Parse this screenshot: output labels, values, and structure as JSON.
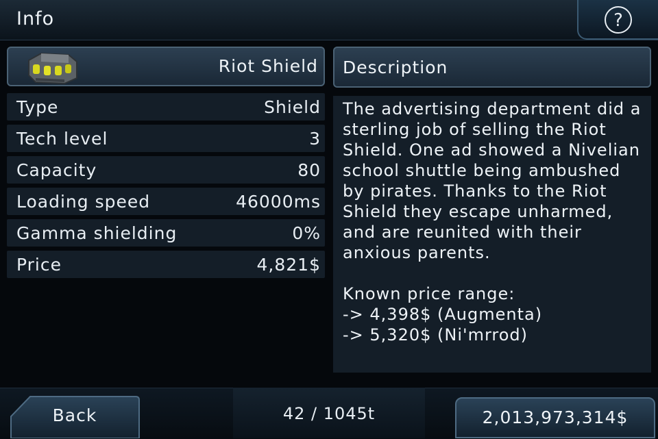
{
  "header": {
    "title": "Info",
    "help_icon": "?"
  },
  "item": {
    "name": "Riot Shield",
    "thumbnail_icon": "shield-generator-icon"
  },
  "stats": [
    {
      "label": "Type",
      "value": "Shield"
    },
    {
      "label": "Tech level",
      "value": "3"
    },
    {
      "label": "Capacity",
      "value": "80"
    },
    {
      "label": "Loading speed",
      "value": "46000ms"
    },
    {
      "label": "Gamma shielding",
      "value": "0%"
    },
    {
      "label": "Price",
      "value": "4,821$"
    }
  ],
  "description": {
    "title": "Description",
    "text": "The advertising department did a sterling job of selling the Riot Shield. One ad showed a Nivelian school shuttle being ambushed by pirates. Thanks to the Riot Shield they escape unharmed, and are reunited with their anxious parents.\n\nKnown price range:\n-> 4,398$ (Augmenta)\n-> 5,320$ (Ni'mrrod)"
  },
  "footer": {
    "back_label": "Back",
    "cargo": "42 / 1045t",
    "money": "2,013,973,314$"
  },
  "colors": {
    "panel": "#141e28",
    "header_bar": "#2c3f51",
    "border": "#4b6275",
    "background": "#05080c"
  }
}
